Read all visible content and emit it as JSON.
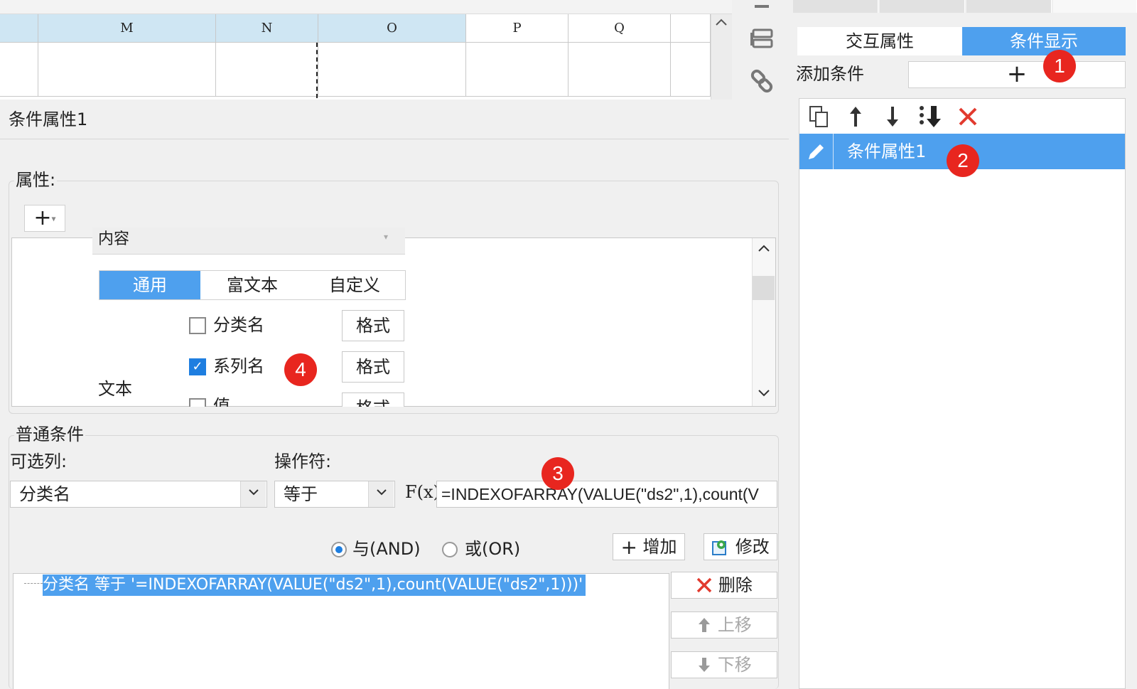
{
  "sheet": {
    "columns": [
      "M",
      "N",
      "O",
      "P",
      "Q"
    ]
  },
  "right_panel": {
    "tabs": [
      "交互属性",
      "条件显示"
    ],
    "add_condition_label": "添加条件",
    "add_condition_button": "+",
    "list_items": [
      {
        "label": "条件属性1"
      }
    ]
  },
  "dialog": {
    "title": "条件属性1",
    "properties_label": "属性:",
    "add_property": "+",
    "content_cut": "内容",
    "segments": [
      "通用",
      "富文本",
      "自定义"
    ],
    "text_label": "文本",
    "checkboxes": [
      {
        "label": "分类名",
        "checked": false,
        "format": "格式"
      },
      {
        "label": "系列名",
        "checked": true,
        "format": "格式"
      },
      {
        "label": "值",
        "checked": false,
        "format": "格式"
      }
    ],
    "normal_condition_label": "普通条件",
    "column_label": "可选列:",
    "operator_label": "操作符:",
    "column_value": "分类名",
    "operator_value": "等于",
    "fx_label": "F(x)",
    "formula": "=INDEXOFARRAY(VALUE(\"ds2\",1),count(V",
    "radio_and": "与(AND)",
    "radio_or": "或(OR)",
    "add_btn": "增加",
    "modify_btn": "修改",
    "condition_expr": "分类名 等于 '=INDEXOFARRAY(VALUE(\"ds2\",1),count(VALUE(\"ds2\",1)))'",
    "delete_btn": "删除",
    "move_up_btn": "上移",
    "move_down_btn": "下移"
  },
  "markers": [
    "1",
    "2",
    "3",
    "4"
  ],
  "colors": {
    "accent": "#4ea0ee",
    "marker": "#e8261f",
    "header_selected": "#cfe6f3"
  }
}
